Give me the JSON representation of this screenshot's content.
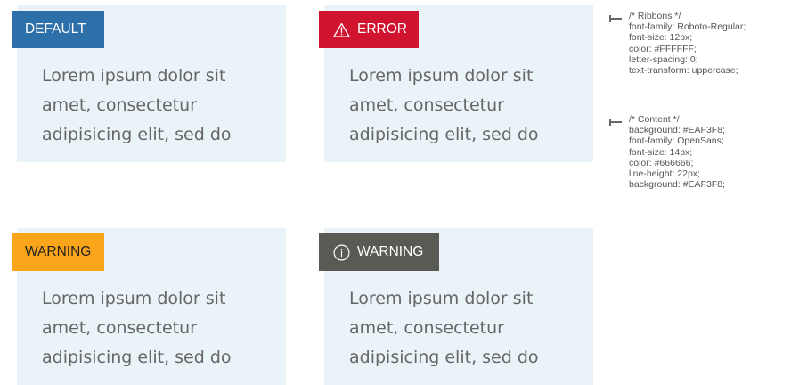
{
  "cards": [
    {
      "ribbon_label": "DEFAULT",
      "ribbon_bg": "#2D6FA8",
      "ribbon_color": "#FFFFFF",
      "icon": "none",
      "content": "Lorem ipsum dolor sit\namet, consectetur\nadipisicing elit, sed do"
    },
    {
      "ribbon_label": "ERROR",
      "ribbon_bg": "#D0142F",
      "ribbon_color": "#FFFFFF",
      "icon": "warning-triangle-icon",
      "content": "Lorem ipsum dolor sit\namet, consectetur\nadipisicing elit, sed do"
    },
    {
      "ribbon_label": "WARNING",
      "ribbon_bg": "#FAA51A",
      "ribbon_color": "#222222",
      "icon": "none",
      "content": "Lorem ipsum dolor sit\namet, consectetur\nadipisicing elit, sed do"
    },
    {
      "ribbon_label": "WARNING",
      "ribbon_bg": "#5A5A55",
      "ribbon_color": "#FFFFFF",
      "icon": "info-circle-icon",
      "content": "Lorem ipsum dolor sit\namet, consectetur\nadipisicing elit, sed do"
    }
  ],
  "colors": {
    "card_background": "#EAF3F8",
    "content_text": "#666666",
    "page_background": "#FFFFFF"
  },
  "specs": {
    "ribbons": "/* Ribbons */\nfont-family: Roboto-Regular;\nfont-size: 12px;\ncolor: #FFFFFF;\nletter-spacing: 0;\ntext-transform: uppercase;",
    "content": "/* Content */\nbackground: #EAF3F8;\nfont-family: OpenSans;\nfont-size: 14px;\ncolor: #666666;\nline-height: 22px;\nbackground: #EAF3F8;"
  }
}
